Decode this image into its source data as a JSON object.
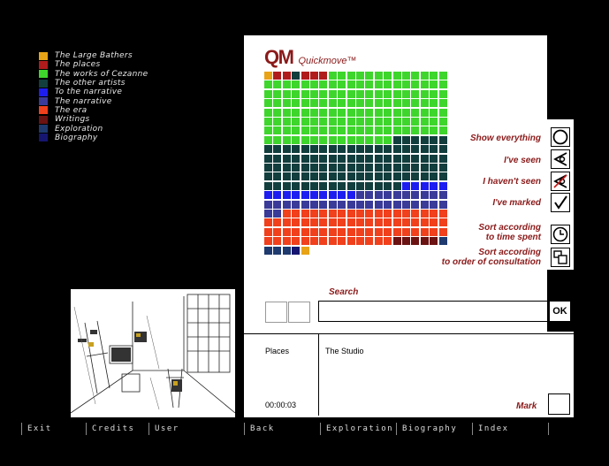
{
  "legend": [
    {
      "label": "The Large Bathers",
      "color": "#e8a317"
    },
    {
      "label": "The places",
      "color": "#b01c1c"
    },
    {
      "label": "The works of Cezanne",
      "color": "#3ed62c"
    },
    {
      "label": "The other artists",
      "color": "#123e3e"
    },
    {
      "label": "To the narrative",
      "color": "#1d1df0"
    },
    {
      "label": "The narrative",
      "color": "#3a3a99"
    },
    {
      "label": "The era",
      "color": "#f0401c"
    },
    {
      "label": "Writings",
      "color": "#6b1212"
    },
    {
      "label": "Exploration",
      "color": "#1e3a6e"
    },
    {
      "label": "Biography",
      "color": "#161670"
    }
  ],
  "logo": {
    "mark": "QM",
    "text": "Quickmove™"
  },
  "options": {
    "show_everything": "Show everything",
    "ive_seen": "I've seen",
    "havent_seen": "I haven't seen",
    "ive_marked": "I've marked",
    "sort_time_line1": "Sort according",
    "sort_time_line2": "to time spent",
    "sort_order_line1": "Sort according",
    "sort_order_line2": "to order of consultation"
  },
  "search": {
    "label": "Search",
    "value": "",
    "ok_label": "OK"
  },
  "info": {
    "category": "Places",
    "title": "The Studio",
    "time": "00:00:03",
    "mark_label": "Mark"
  },
  "nav": [
    "Exit",
    "Credits",
    "User",
    "Back",
    "Exploration",
    "Biography",
    "Index"
  ],
  "colors": {
    "accent": "#8b1a1a",
    "bathers": "#e8a317",
    "places": "#b01c1c",
    "works": "#3ed62c",
    "other_artists": "#123e3e",
    "to_narrative": "#1d1df0",
    "narrative": "#3a3a99",
    "era": "#f0401c",
    "writings": "#6b1212",
    "exploration": "#1e3a6e",
    "biography": "#161670"
  }
}
